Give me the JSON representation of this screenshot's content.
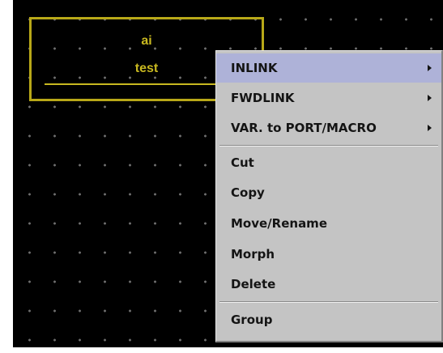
{
  "record": {
    "type_label": "ai",
    "name_label": "test"
  },
  "context_menu": {
    "items": [
      {
        "label": "INLINK",
        "submenu": true,
        "selected": true
      },
      {
        "label": "FWDLINK",
        "submenu": true,
        "selected": false
      },
      {
        "label": "VAR. to PORT/MACRO",
        "submenu": true,
        "selected": false
      },
      {
        "label": "Cut",
        "submenu": false,
        "selected": false
      },
      {
        "label": "Copy",
        "submenu": false,
        "selected": false
      },
      {
        "label": "Move/Rename",
        "submenu": false,
        "selected": false
      },
      {
        "label": "Morph",
        "submenu": false,
        "selected": false
      },
      {
        "label": "Delete",
        "submenu": false,
        "selected": false
      },
      {
        "label": "Group",
        "submenu": false,
        "selected": false
      }
    ]
  },
  "colors": {
    "canvas_background": "#000000",
    "grid_dot": "#6e6e6e",
    "record_outline": "#b8a818",
    "menu_background": "#c4c4c4",
    "menu_selection": "#aeb2d8"
  },
  "icons": {
    "submenu_indicator": "submenu-arrow-icon"
  }
}
